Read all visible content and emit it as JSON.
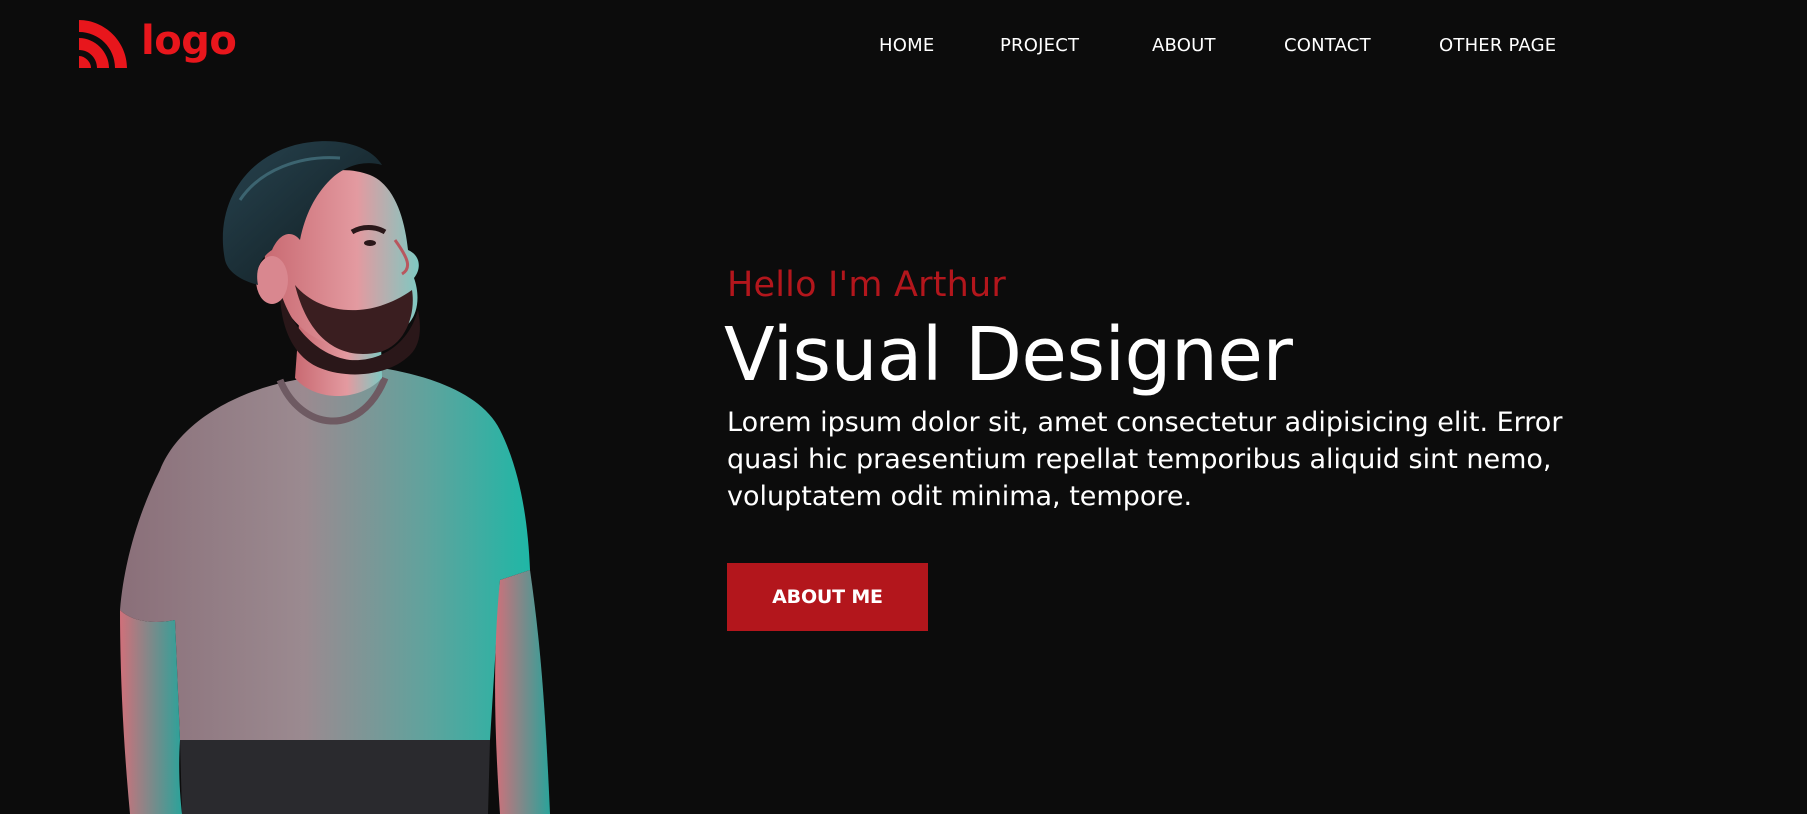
{
  "brand": {
    "logo_text": "logo",
    "icon": "wifi-signal-icon",
    "color": "#e8161c"
  },
  "nav": {
    "items": [
      {
        "label": "HOME"
      },
      {
        "label": "PROJECT"
      },
      {
        "label": "ABOUT"
      },
      {
        "label": "CONTACT"
      },
      {
        "label": "OTHER PAGE"
      }
    ]
  },
  "hero": {
    "greeting": "Hello I'm Arthur",
    "role": "Visual Designer",
    "description": "Lorem ipsum dolor sit, amet consectetur adipisicing elit. Error quasi hic praesentium repellat temporibus aliquid sint nemo, voluptatem odit minima, tempore.",
    "cta_label": "ABOUT ME"
  },
  "colors": {
    "background": "#0c0c0c",
    "accent": "#b3161c",
    "text": "#ffffff"
  }
}
